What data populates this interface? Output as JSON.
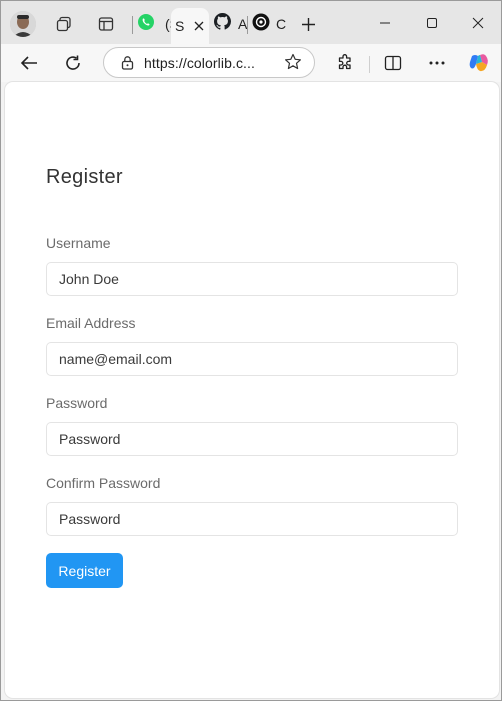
{
  "browser": {
    "tabs": [
      {
        "icon": "whatsapp-icon",
        "title": "(S"
      },
      {
        "icon": "page-icon",
        "title": "S"
      },
      {
        "icon": "github-icon",
        "title": "A"
      },
      {
        "icon": "openai-icon",
        "title": "C"
      }
    ],
    "address_url": "https://colorlib.c...",
    "brand_color": "#2196f3",
    "whatsapp_color": "#25d366"
  },
  "page": {
    "title": "Register",
    "fields": [
      {
        "label": "Username",
        "placeholder": "John Doe"
      },
      {
        "label": "Email Address",
        "placeholder": "name@email.com"
      },
      {
        "label": "Password",
        "placeholder": "Password"
      },
      {
        "label": "Confirm Password",
        "placeholder": "Password"
      }
    ],
    "submit_label": "Register"
  }
}
